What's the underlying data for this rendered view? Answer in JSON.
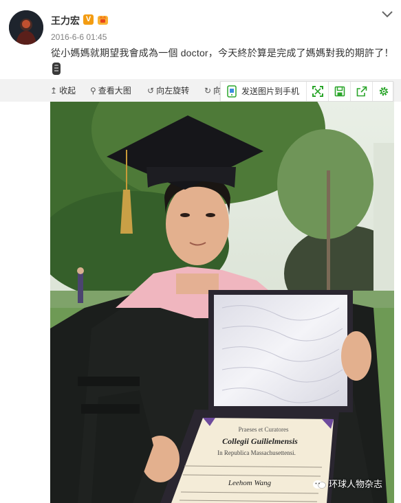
{
  "user": {
    "name": "王力宏",
    "verified_badge": "V",
    "badge_color": "#f39c12"
  },
  "post": {
    "time": "2016-6-6 01:45",
    "text": "從小媽媽就期望我會成為一個 doctor，今天終於算是完成了媽媽對我的期許了！",
    "emoji": "film-strip-icon"
  },
  "toolbar": {
    "collapse": "收起",
    "view_large": "查看大图",
    "rotate_left": "向左旋转",
    "rotate_right_partial": "向",
    "send_to_phone": "发送图片到手机",
    "accent": "#2aa52a"
  },
  "photo": {
    "diploma_title": "Collegii Guilielmensis",
    "diploma_recipient": "Leehom Wang",
    "watermark": "环球人物杂志"
  }
}
